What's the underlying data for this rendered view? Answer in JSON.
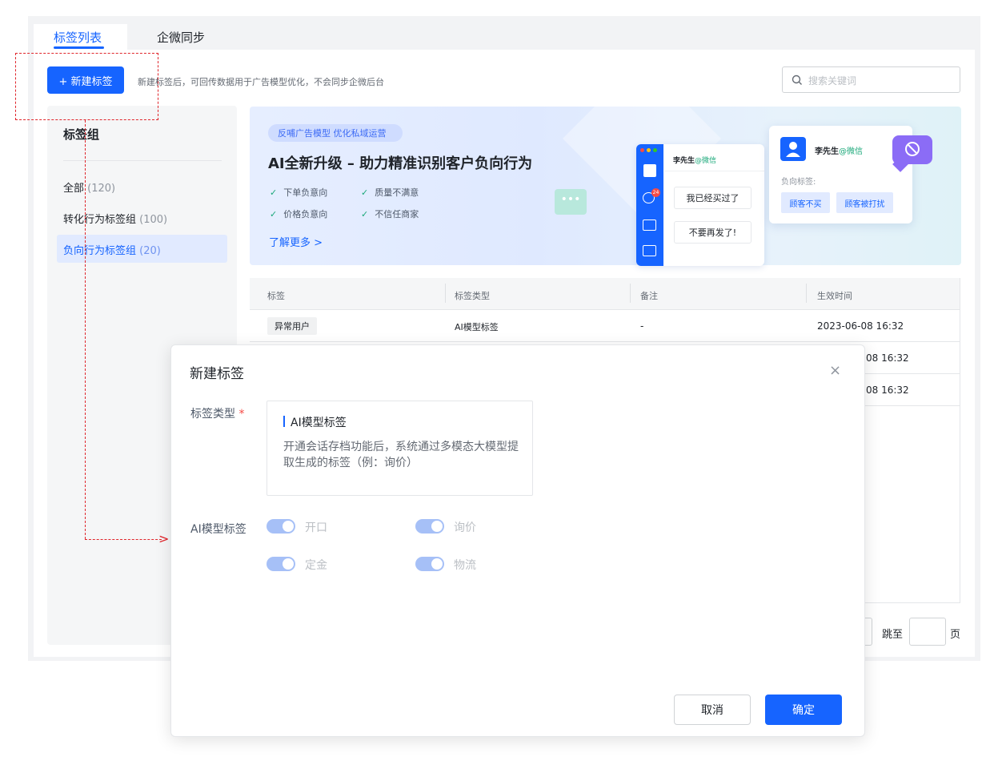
{
  "tabs": [
    {
      "label": "标签列表",
      "active": true
    },
    {
      "label": "企微同步",
      "active": false
    }
  ],
  "toolbar": {
    "new_tag_label": "+ 新建标签",
    "hint": "新建标签后，可回传数据用于广告模型优化，不会同步企微后台",
    "search_placeholder": "搜索关键词"
  },
  "sidebar": {
    "title": "标签组",
    "items": [
      {
        "label": "全部",
        "count": "(120)",
        "active": false
      },
      {
        "label": "转化行为标签组",
        "count": "(100)",
        "active": false
      },
      {
        "label": "负向行为标签组",
        "count": "(20)",
        "active": true
      }
    ]
  },
  "banner": {
    "tag": "反哺广告模型 优化私域运营",
    "title": "AI全新升级 – 助力精准识别客户负向行为",
    "features": [
      "下单负意向",
      "质量不满意",
      "价格负意向",
      "不信任商家"
    ],
    "more": "了解更多 >",
    "phone": {
      "name": "李先生",
      "wx": "@微信",
      "messages": [
        "我已经买过了",
        "不要再发了!"
      ],
      "badge": "24"
    },
    "card": {
      "name": "李先生",
      "wx": "@微信",
      "sub": "负向标签:",
      "tags": [
        "顾客不买",
        "顾客被打扰"
      ]
    }
  },
  "table": {
    "headers": [
      "标签",
      "标签类型",
      "备注",
      "生效时间"
    ],
    "rows": [
      {
        "tag": "异常用户",
        "type": "AI模型标签",
        "note": "-",
        "time": "2023-06-08 16:32"
      },
      {
        "time": "08 16:32"
      },
      {
        "time": "08 16:32"
      }
    ]
  },
  "pagination": {
    "goto": "跳至",
    "page": "页"
  },
  "modal": {
    "title": "新建标签",
    "close": "×",
    "type_label": "标签类型",
    "required": "*",
    "type_option": {
      "title": "AI模型标签",
      "desc": "开通会话存档功能后，系统通过多模态大模型提取生成的标签（例：询价）"
    },
    "ai_label": "AI模型标签",
    "toggles": [
      {
        "label": "开口",
        "on": true
      },
      {
        "label": "询价",
        "on": true
      },
      {
        "label": "定金",
        "on": true
      },
      {
        "label": "物流",
        "on": true
      }
    ],
    "cancel": "取消",
    "ok": "确定"
  },
  "colors": {
    "primary": "#1664ff",
    "annotation": "#e0262c",
    "check": "#1aa879",
    "badge": "#8b6cf6"
  }
}
